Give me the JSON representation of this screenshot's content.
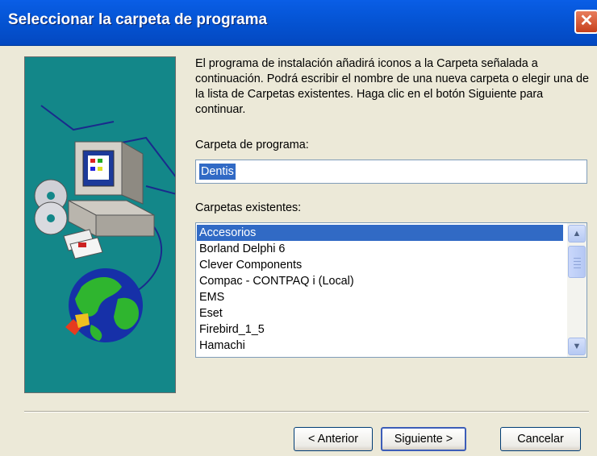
{
  "window": {
    "title": "Seleccionar la carpeta de programa",
    "close_glyph": "✕"
  },
  "intro_text": "El programa de instalación añadirá iconos a la Carpeta señalada a continuación. Podrá escribir el nombre de una nueva carpeta o elegir una de la lista de Carpetas existentes. Haga clic en el botón Siguiente para continuar.",
  "program_folder": {
    "label": "Carpeta de programa:",
    "value": "Dentis"
  },
  "existing_folders": {
    "label": "Carpetas existentes:",
    "items": [
      "Accesorios",
      "Borland Delphi 6",
      "Clever Components",
      "Compac - CONTPAQ i (Local)",
      "EMS",
      "Eset",
      "Firebird_1_5",
      "Hamachi"
    ],
    "selected_index": 0
  },
  "buttons": {
    "back": "< Anterior",
    "next": "Siguiente >",
    "cancel": "Cancelar"
  },
  "colors": {
    "titlebar": "#0555d6",
    "selection": "#316ac5",
    "side_panel": "#138789",
    "dialog_bg": "#ece9d8"
  },
  "icons": [
    "close-icon",
    "computer-setup-illustration",
    "scroll-up-icon",
    "scroll-down-icon"
  ]
}
